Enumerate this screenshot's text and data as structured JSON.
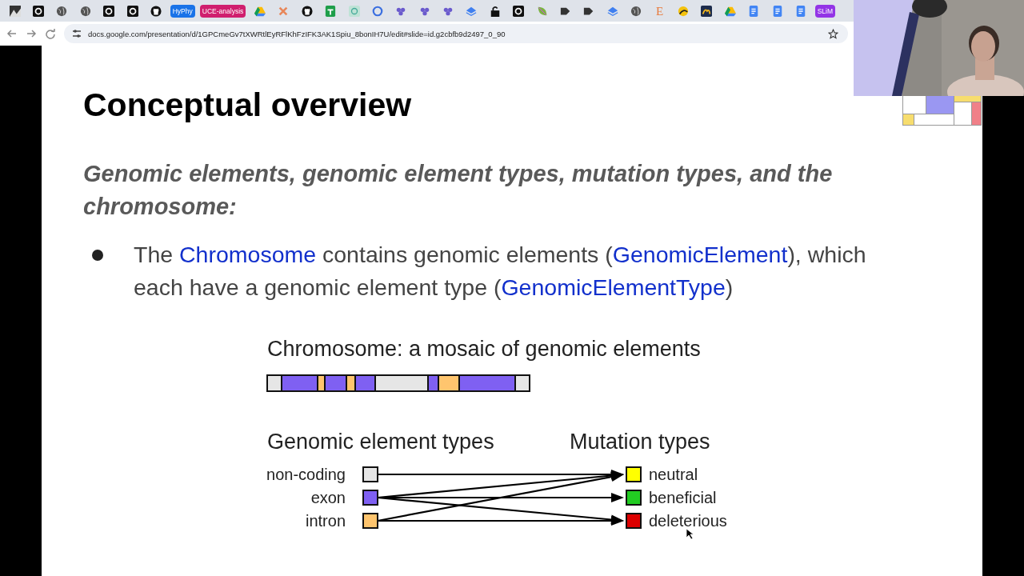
{
  "bookmarks": [
    {
      "kind": "icon"
    },
    {
      "kind": "icon"
    },
    {
      "kind": "icon"
    },
    {
      "kind": "icon"
    },
    {
      "kind": "icon"
    },
    {
      "kind": "icon"
    },
    {
      "kind": "icon"
    },
    {
      "kind": "chip",
      "label": "HyPhy",
      "color": "#1a73e8"
    },
    {
      "kind": "chip",
      "label": "UCE-analysis",
      "color": "#d01f6e"
    },
    {
      "kind": "icon"
    },
    {
      "kind": "icon"
    },
    {
      "kind": "icon"
    },
    {
      "kind": "icon"
    },
    {
      "kind": "icon"
    },
    {
      "kind": "icon"
    },
    {
      "kind": "icon"
    },
    {
      "kind": "icon"
    },
    {
      "kind": "icon"
    },
    {
      "kind": "icon"
    },
    {
      "kind": "icon"
    },
    {
      "kind": "icon"
    },
    {
      "kind": "icon"
    },
    {
      "kind": "icon"
    },
    {
      "kind": "icon"
    },
    {
      "kind": "icon"
    },
    {
      "kind": "icon"
    },
    {
      "kind": "glyph",
      "label": "E"
    },
    {
      "kind": "icon"
    },
    {
      "kind": "icon"
    },
    {
      "kind": "icon"
    },
    {
      "kind": "icon"
    },
    {
      "kind": "icon"
    },
    {
      "kind": "icon"
    },
    {
      "kind": "chip",
      "label": "SLiM",
      "color": "#9334e6"
    }
  ],
  "address_bar": {
    "url": "docs.google.com/presentation/d/1GPCmeGv7tXWRtlEyRFlKhFzIFK3AK1Spiu_8bonIH7U/edit#slide=id.g2cbfb9d2497_0_90"
  },
  "slide": {
    "title": "Conceptual overview",
    "subtitle": "Genomic elements, genomic element types, mutation types, and the chromosome:",
    "bullets": [
      {
        "parts": [
          {
            "kind": "plain",
            "text": "The "
          },
          {
            "kind": "class",
            "text": "Chromosome"
          },
          {
            "kind": "plain",
            "text": " contains genomic elements ("
          },
          {
            "kind": "class",
            "text": "GenomicElement"
          },
          {
            "kind": "plain",
            "text": "), which each have a genomic element type ("
          },
          {
            "kind": "class",
            "text": "GenomicElementType"
          },
          {
            "kind": "plain",
            "text": ")"
          }
        ]
      }
    ],
    "diagram": {
      "chromosome_title": "Chromosome: a mosaic of genomic elements",
      "segments": [
        {
          "color": "#e6e6e6"
        },
        {
          "color": "#7f60f2"
        },
        {
          "color": "#ffc56e"
        },
        {
          "color": "#7f60f2"
        },
        {
          "color": "#ffc56e"
        },
        {
          "color": "#7f60f2"
        },
        {
          "color": "#e6e6e6"
        },
        {
          "color": "#7f60f2"
        },
        {
          "color": "#ffc56e"
        },
        {
          "color": "#7f60f2"
        },
        {
          "color": "#e6e6e6"
        }
      ],
      "element_types_title": "Genomic element types",
      "mutation_types_title": "Mutation types",
      "element_types": [
        {
          "label": "non-coding",
          "color": "#e6e6e6"
        },
        {
          "label": "exon",
          "color": "#7f60f2"
        },
        {
          "label": "intron",
          "color": "#ffc56e"
        }
      ],
      "mutation_types": [
        {
          "label": "neutral",
          "color": "#ffff00"
        },
        {
          "label": "beneficial",
          "color": "#22cc22"
        },
        {
          "label": "deleterious",
          "color": "#dd0000"
        }
      ]
    }
  }
}
